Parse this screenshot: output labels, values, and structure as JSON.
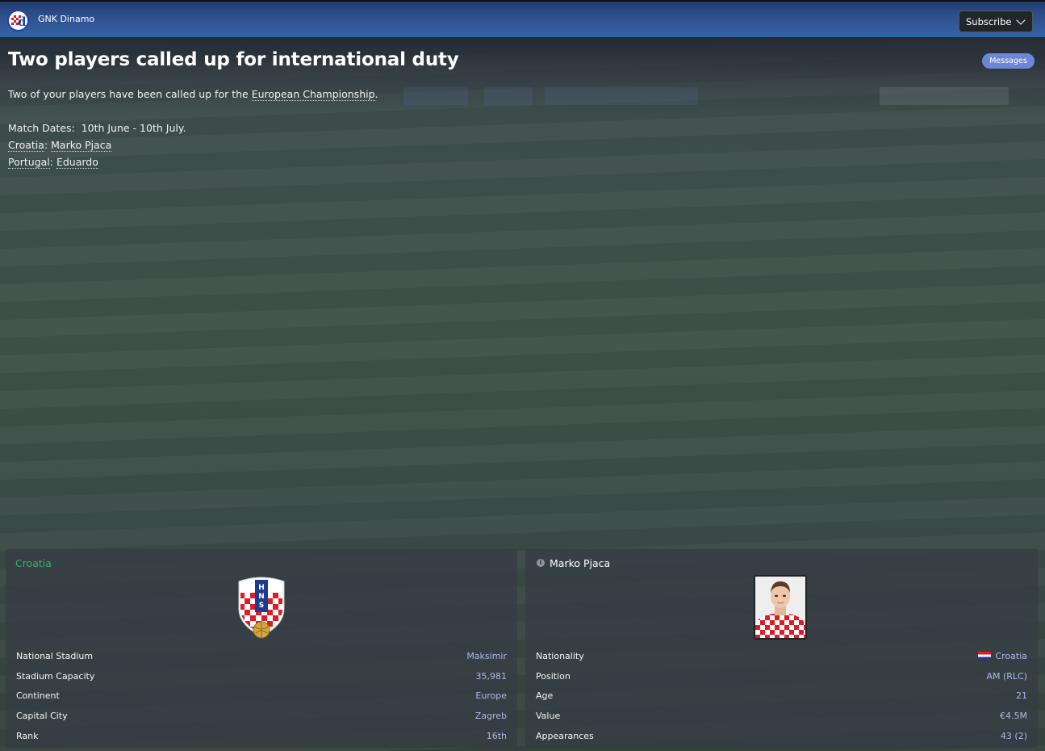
{
  "header": {
    "club_name": "GNK Dinamo",
    "subscribe_label": "Subscribe"
  },
  "message": {
    "title": "Two players called up for international duty",
    "badge": "Messages",
    "intro_prefix": "Two of your players have been called up for the ",
    "intro_link": "European Championship",
    "intro_suffix": ".",
    "dates_label": "Match Dates:",
    "dates_value": "10th June - 10th July",
    "dates_suffix": ".",
    "callups": [
      {
        "country": "Croatia",
        "player": "Marko Pjaca"
      },
      {
        "country": "Portugal",
        "player": "Eduardo"
      }
    ]
  },
  "nation_panel": {
    "title": "Croatia",
    "crest_icon": "croatia-federation-crest-icon",
    "rows": [
      {
        "label": "National Stadium",
        "value": "Maksimir"
      },
      {
        "label": "Stadium Capacity",
        "value": "35,981"
      },
      {
        "label": "Continent",
        "value": "Europe"
      },
      {
        "label": "Capital City",
        "value": "Zagreb"
      },
      {
        "label": "Rank",
        "value": "16th"
      }
    ]
  },
  "player_panel": {
    "title": "Marko Pjaca",
    "info_icon": "info-icon",
    "rows": [
      {
        "label": "Nationality",
        "value": "Croatia",
        "flag": "croatia-flag-icon"
      },
      {
        "label": "Position",
        "value": "AM (RLC)"
      },
      {
        "label": "Age",
        "value": "21"
      },
      {
        "label": "Value",
        "value": "€4.5M"
      },
      {
        "label": "Appearances",
        "value": "43 (2)"
      }
    ]
  },
  "colors": {
    "header_bar": "#3564a6",
    "badge": "#6d86d8",
    "panel_title_green": "#3fae6a",
    "value_text": "#aeb8e8"
  }
}
